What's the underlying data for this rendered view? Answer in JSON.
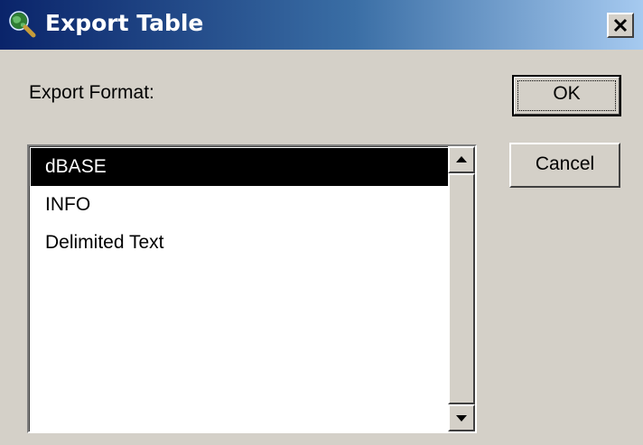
{
  "window": {
    "title": "Export Table",
    "icon": "globe-magnifier-icon",
    "close_icon": "close-icon"
  },
  "form": {
    "format_label": "Export Format:"
  },
  "format_list": {
    "selected_index": 0,
    "items": [
      {
        "label": "dBASE"
      },
      {
        "label": "INFO"
      },
      {
        "label": "Delimited Text"
      }
    ]
  },
  "buttons": {
    "ok_label": "OK",
    "cancel_label": "Cancel"
  },
  "colors": {
    "titlebar_start": "#0a246a",
    "titlebar_end": "#a6caf0",
    "face": "#d4d0c8",
    "selection": "#000000"
  }
}
